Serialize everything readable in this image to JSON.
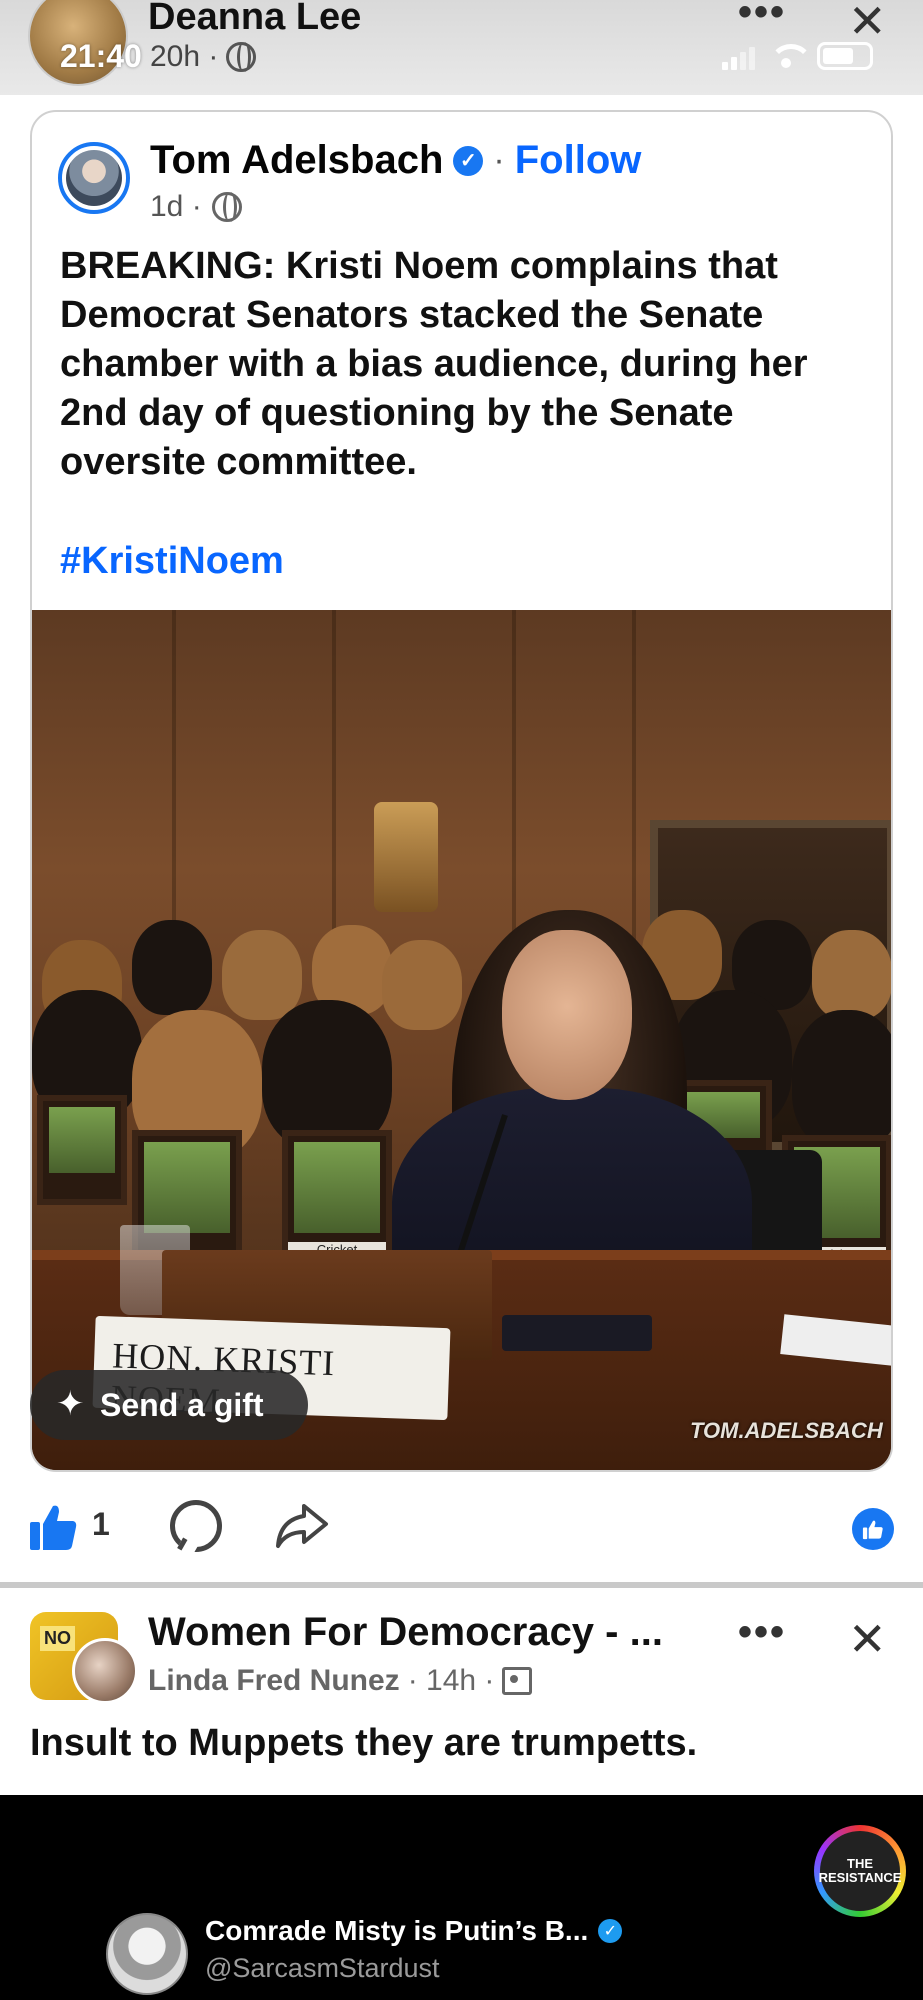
{
  "top_header": {
    "name": "Deanna Lee",
    "status_time": "21:40",
    "age": "20h ·",
    "more_label": "•••",
    "close_label": "✕"
  },
  "shared_post": {
    "author": "Tom Adelsbach",
    "dot": "·",
    "follow_label": "Follow",
    "age": "1d ·",
    "text": "BREAKING: Kristi Noem complains that Democrat Senators stacked the Senate chamber with a bias audience, during her 2nd day of questioning by the Senate oversite committee.",
    "hashtag": "#KristiNoem",
    "image": {
      "nameplate": "HON. KRISTI NOEM",
      "frame_label": "Cricket",
      "watermark": "TOM.ADELSBACH"
    },
    "gift_label": "Send a gift"
  },
  "actions": {
    "like_count": "1"
  },
  "post2": {
    "group": "Women For Democracy - ...",
    "avatar_sign": "NO",
    "author": "Linda Fred Nunez",
    "age": "· 14h ·",
    "more_label": "•••",
    "close_label": "✕",
    "text": "Insult to Muppets they are trumpetts."
  },
  "embed": {
    "badge": "THE RESISTANCE",
    "name": "Comrade Misty is Putin’s B...",
    "handle": "@SarcasmStardust"
  },
  "colors": {
    "accent": "#0866ff",
    "like_blue": "#1877f2",
    "text": "#050505"
  }
}
